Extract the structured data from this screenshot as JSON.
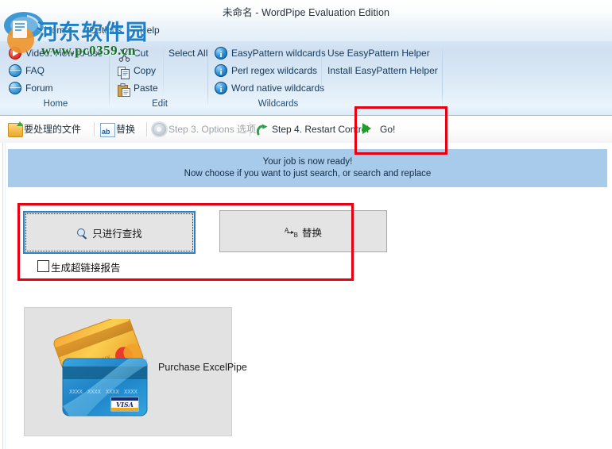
{
  "window": {
    "title": "未命名 - WordPipe Evaluation Edition"
  },
  "watermark": {
    "site_name": "河东软件园",
    "url": "www.pc0359.cn"
  },
  "menubar": {
    "items": [
      {
        "label": "Home"
      },
      {
        "label": "Options"
      },
      {
        "label": "Help"
      }
    ]
  },
  "ribbon": {
    "groups": [
      {
        "title": "Home",
        "items": [
          {
            "label": "Video: How to use",
            "icon": "video-play-icon"
          },
          {
            "label": "FAQ",
            "icon": "globe-icon"
          },
          {
            "label": "Forum",
            "icon": "globe-icon"
          }
        ]
      },
      {
        "title": "Edit",
        "items": [
          {
            "label": "Cut",
            "icon": "scissors-icon"
          },
          {
            "label": "Copy",
            "icon": "copy-icon"
          },
          {
            "label": "Paste",
            "icon": "clipboard-icon"
          },
          {
            "label": "Select All",
            "icon": "none"
          }
        ]
      },
      {
        "title": "Wildcards",
        "items": [
          {
            "label": "EasyPattern wildcards",
            "icon": "info-icon"
          },
          {
            "label": "Perl regex wildcards",
            "icon": "info-icon"
          },
          {
            "label": "Word native wildcards",
            "icon": "info-icon"
          },
          {
            "label": "Use EasyPattern Helper",
            "icon": "none"
          },
          {
            "label": "Install EasyPattern Helper",
            "icon": "none"
          }
        ]
      }
    ]
  },
  "steps_toolbar": {
    "items": [
      {
        "label": "要处理的文件",
        "icon": "open-folder-icon",
        "enabled": true
      },
      {
        "label": "替换",
        "icon": "replace-ab-icon",
        "enabled": true
      },
      {
        "label": "Step 3. Options 选项",
        "icon": "gear-icon",
        "enabled": false
      },
      {
        "label": "Step 4. Restart Control",
        "icon": "restart-arrow-icon",
        "enabled": true
      },
      {
        "label": "Go!",
        "icon": "green-play-icon",
        "enabled": true
      }
    ]
  },
  "banner": {
    "line1": "Your job is now ready!",
    "line2": "Now choose if you want to just search, or search and replace"
  },
  "actions": {
    "search_only_button": {
      "label": "只进行查找",
      "icon": "find-magnifier-icon",
      "focused": true
    },
    "replace_button": {
      "label": "替换",
      "icon": "a-to-b-icon",
      "focused": false
    },
    "hyperlink_report_checkbox": {
      "label": "生成超链接报告",
      "checked": false
    }
  },
  "purchase_panel": {
    "label": "Purchase ExcelPipe",
    "card_brand": "VISA",
    "card_digits": "XXXX XXXX XXXX XXXX"
  },
  "annotations": {
    "highlight_color": "#e60012",
    "boxes": [
      {
        "name": "go-button-highlight"
      },
      {
        "name": "action-buttons-highlight"
      }
    ]
  },
  "colors": {
    "banner_bg": "#a8cbec",
    "ribbon_top": "#d7e6f4",
    "focus_border": "#2a7fc9",
    "button_face": "#e4e4e4"
  }
}
